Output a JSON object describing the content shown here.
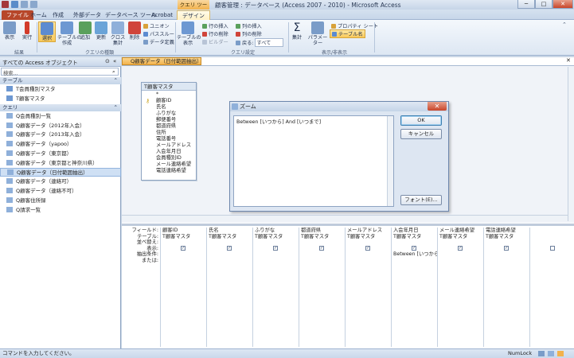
{
  "window": {
    "title": "顧客管理 : データベース (Access 2007 - 2010) - Microsoft Access",
    "context_tab": "クエリ ツール",
    "controls": [
      "─",
      "□",
      "✕"
    ]
  },
  "tabs": [
    "ファイル",
    "ホーム",
    "作成",
    "外部データ",
    "データベース ツール",
    "Acrobat",
    "デザイン"
  ],
  "ribbon": {
    "groups": {
      "results": "結果",
      "query_type": "クエリの種類",
      "query_setup": "クエリ設定",
      "show_hide": "表示/非表示"
    },
    "buttons": {
      "view": "表示",
      "run": "実行",
      "select": "選択",
      "make_table": "テーブルの\n作成",
      "append": "追加",
      "update": "更新",
      "crosstab": "クロス\n集計",
      "delete": "削除",
      "union": "ユニオン",
      "passthrough": "パススルー",
      "data_def": "データ定義",
      "show_table": "テーブルの\n表示",
      "insert_rows": "行の挿入",
      "delete_rows": "行の削除",
      "builder": "ビルダー",
      "insert_cols": "列の挿入",
      "delete_cols": "列の削除",
      "return_label": "戻る:",
      "return_value": "すべて",
      "totals": "集計",
      "parameters": "パラメーター",
      "property_sheet": "プロパティ シート",
      "table_names": "テーブル名"
    }
  },
  "nav": {
    "header": "すべての Access オブジェクト",
    "search_placeholder": "検索...",
    "sections": [
      {
        "label": "テーブル",
        "items": [
          "T会員種別マスタ",
          "T顧客マスタ"
        ]
      },
      {
        "label": "クエリ",
        "items": [
          "Q会員種別一覧",
          "Q顧客データ（2012年入会）",
          "Q顧客データ（2013年入会）",
          "Q顧客データ（yapoo）",
          "Q顧客データ（東京都）",
          "Q顧客データ（東京都と神奈川県）",
          "Q顧客データ（日付範囲抽出）",
          "Q顧客データ（連絡可）",
          "Q顧客データ（連絡不可）",
          "Q顧客住所録",
          "Q請求一覧"
        ]
      }
    ],
    "selected_item": "Q顧客データ（日付範囲抽出）"
  },
  "doc_tab": "Q顧客データ（日付範囲抽出）",
  "field_list": {
    "title": "T顧客マスタ",
    "fields": [
      "*",
      "顧客ID",
      "氏名",
      "ふりがな",
      "郵便番号",
      "都道府県",
      "住所",
      "電話番号",
      "メールアドレス",
      "入会年月日",
      "会員種別ID",
      "メール連絡希望",
      "電話連絡希望"
    ],
    "key_field": "顧客ID"
  },
  "zoom": {
    "title": "ズーム",
    "text": "Between [いつから] And [いつまで]",
    "ok": "OK",
    "cancel": "キャンセル",
    "font": "フォント(E)..."
  },
  "grid": {
    "row_labels": [
      "フィールド:",
      "テーブル:",
      "並べ替え:",
      "表示:",
      "抽出条件:",
      "または:"
    ],
    "columns": [
      {
        "field": "顧客ID",
        "table": "T顧客マスタ",
        "show": true,
        "criteria": ""
      },
      {
        "field": "氏名",
        "table": "T顧客マスタ",
        "show": true,
        "criteria": ""
      },
      {
        "field": "ふりがな",
        "table": "T顧客マスタ",
        "show": true,
        "criteria": ""
      },
      {
        "field": "都道府県",
        "table": "T顧客マスタ",
        "show": true,
        "criteria": ""
      },
      {
        "field": "メールアドレス",
        "table": "T顧客マスタ",
        "show": true,
        "criteria": ""
      },
      {
        "field": "入会年月日",
        "table": "T顧客マスタ",
        "show": true,
        "criteria": "Between [いつから] A"
      },
      {
        "field": "メール連絡希望",
        "table": "T顧客マスタ",
        "show": true,
        "criteria": ""
      },
      {
        "field": "電話連絡希望",
        "table": "T顧客マスタ",
        "show": true,
        "criteria": ""
      },
      {
        "field": "",
        "table": "",
        "show": false,
        "criteria": ""
      }
    ]
  },
  "status": {
    "left": "コマンドを入力してください。",
    "numlock": "NumLock"
  },
  "colors": {
    "file_tab": "#b7472a",
    "doc_tab": "#f2b24c",
    "selection": "#cfe0f4"
  }
}
